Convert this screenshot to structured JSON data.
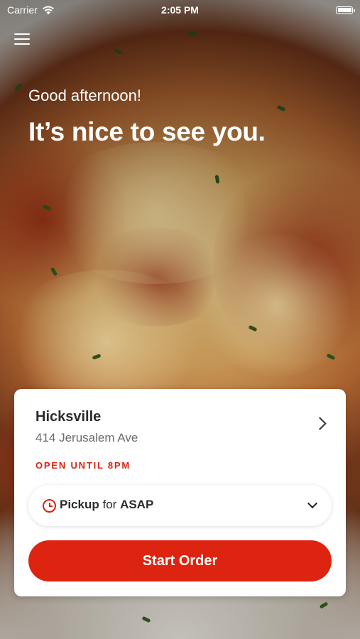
{
  "status_bar": {
    "carrier": "Carrier",
    "time": "2:05 PM"
  },
  "hero": {
    "greeting": "Good afternoon!",
    "headline": "It’s nice to see you."
  },
  "location": {
    "name": "Hicksville",
    "address": "414 Jerusalem Ave",
    "open_status": "OPEN UNTIL 8PM"
  },
  "order_mode": {
    "mode": "Pickup",
    "connector": "for",
    "time": "ASAP"
  },
  "actions": {
    "start_order_label": "Start Order"
  },
  "colors": {
    "accent": "#dc2410"
  },
  "icons": [
    "wifi-icon",
    "battery-icon",
    "menu-icon",
    "chevron-right-icon",
    "clock-icon",
    "chevron-down-icon"
  ]
}
